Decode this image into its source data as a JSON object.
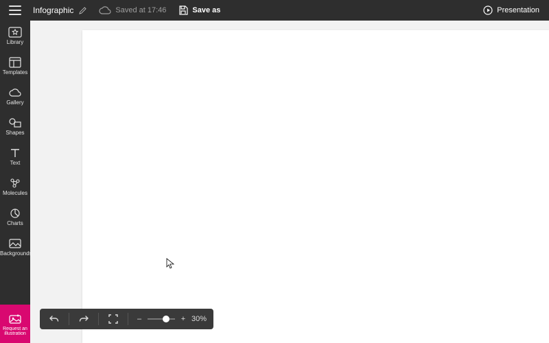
{
  "header": {
    "doc_title": "Infographic",
    "saved_text": "Saved at 17:46",
    "save_as_label": "Save as",
    "presentation_label": "Presentation"
  },
  "sidebar": {
    "items": [
      {
        "id": "library",
        "label": "Library"
      },
      {
        "id": "templates",
        "label": "Templates"
      },
      {
        "id": "gallery",
        "label": "Gallery"
      },
      {
        "id": "shapes",
        "label": "Shapes"
      },
      {
        "id": "text",
        "label": "Text"
      },
      {
        "id": "molecules",
        "label": "Molecules"
      },
      {
        "id": "charts",
        "label": "Charts"
      },
      {
        "id": "backgrounds",
        "label": "Backgrounds"
      }
    ],
    "request_label": "Request an illustration"
  },
  "bottombar": {
    "zoom_minus": "–",
    "zoom_plus": "+",
    "zoom_value": "30%"
  },
  "colors": {
    "chrome": "#2e2e2e",
    "accent": "#d90870"
  }
}
